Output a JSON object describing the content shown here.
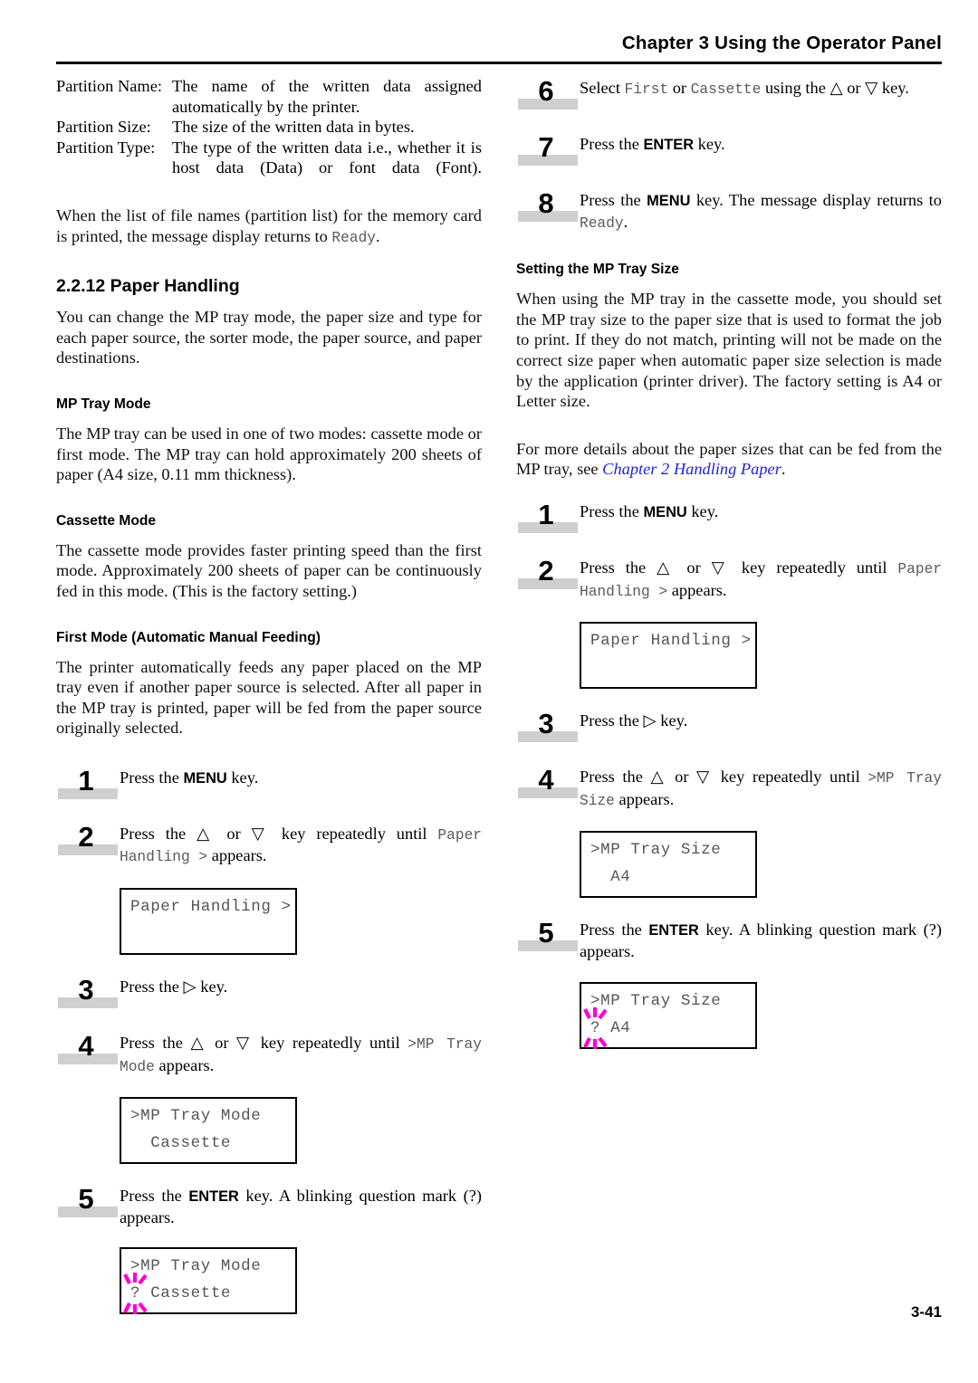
{
  "header": {
    "title": "Chapter 3  Using the Operator Panel"
  },
  "footer": {
    "page_number": "3-41"
  },
  "colors": {
    "link": "#2222dd",
    "blink_marker": "#ff00cc",
    "step_bar": "#cfcfcf",
    "lcd_text": "#555555"
  },
  "left_column": {
    "definitions": [
      {
        "term": "Partition Name:",
        "desc": "The name of the written data assigned automatically by the printer."
      },
      {
        "term": "Partition Size:",
        "desc": "The size of the written data in bytes."
      },
      {
        "term": "Partition Type:",
        "desc": "The type of the written data i.e., whether it is host data (Data) or font data (Font)."
      }
    ],
    "intro_paragraph_a": "When the list of file names (partition list) for the memory card is printed, the message display returns to ",
    "intro_paragraph_b": "Ready",
    "intro_paragraph_c": ".",
    "section_heading": "2.2.12 Paper Handling",
    "section_paragraph": "You can change the MP tray mode, the paper size and type for each paper source, the sorter mode, the paper source, and paper destinations.",
    "mp_tray_mode_heading": "MP Tray Mode",
    "mp_tray_mode_paragraph": "The MP tray can be used in one of two modes: cassette mode or first mode. The MP tray can hold approximately 200 sheets of paper (A4 size, 0.11 mm thickness).",
    "cassette_mode_heading": "Cassette Mode",
    "cassette_mode_paragraph": "The cassette mode provides faster printing speed than the first mode. Approximately 200 sheets of paper can be continuously fed in this mode. (This is the factory setting.)",
    "first_mode_heading": "First Mode (Automatic Manual Feeding)",
    "first_mode_paragraph": "The printer automatically feeds any paper placed on the MP tray even if another paper source is selected. After all paper in the MP tray is printed, paper will be fed from the paper source originally selected.",
    "steps": [
      {
        "number": "1",
        "text_a": "Press the ",
        "key": "MENU",
        "text_b": " key."
      },
      {
        "number": "2",
        "text_a": "Press the ",
        "tri_up": "△",
        "text_or": " or ",
        "tri_down": "▽",
        "text_b": " key repeatedly until ",
        "mono": "Paper Handling >",
        "text_c": " appears."
      },
      {
        "number": "3",
        "text_a": "Press the ",
        "tri_right": "▷",
        "text_b": " key."
      },
      {
        "number": "4",
        "text_a": "Press the ",
        "tri_up": "△",
        "text_or": " or ",
        "tri_down": "▽",
        "text_b": " key repeatedly until ",
        "mono": ">MP Tray Mode",
        "text_c": " appears."
      },
      {
        "number": "5",
        "text_a": "Press the ",
        "key": "ENTER",
        "text_b": " key. A blinking question mark (?) appears."
      }
    ],
    "displays": [
      {
        "line1": "Paper Handling >",
        "line2": ""
      },
      {
        "line1": ">MP Tray Mode",
        "line2": "  Cassette"
      },
      {
        "line1": ">MP Tray Mode",
        "line2": "? Cassette",
        "blinking": "?"
      }
    ]
  },
  "right_column": {
    "steps_top": [
      {
        "number": "6",
        "text_a": "Select ",
        "mono_a": "First",
        "text_b": " or ",
        "mono_b": "Cassette",
        "text_c": " using the ",
        "tri_up": "△",
        "text_or": " or ",
        "tri_down": "▽",
        "text_d": " key."
      },
      {
        "number": "7",
        "text_a": "Press the ",
        "key": "ENTER",
        "text_b": " key."
      },
      {
        "number": "8",
        "text_a": "Press the ",
        "key": "MENU",
        "text_b": " key. The message display returns to ",
        "mono": "Ready",
        "text_c": "."
      }
    ],
    "mp_tray_size_heading": "Setting the MP Tray Size",
    "mp_tray_size_paragraph": "When using the MP tray in the cassette mode, you should set the MP tray size to the paper size that is used to format the job to print. If they do not match, printing will not be made on the correct size paper when automatic paper size selection is made by the application (printer driver). The factory setting is A4 or Letter size.",
    "details_paragraph_a": "For more details about the paper sizes that can be fed from the MP tray, see ",
    "details_link": "Chapter 2 Handling Paper",
    "details_paragraph_b": ".",
    "steps_bottom": [
      {
        "number": "1",
        "text_a": "Press the ",
        "key": "MENU",
        "text_b": " key."
      },
      {
        "number": "2",
        "text_a": "Press the ",
        "tri_up": "△",
        "text_or": " or ",
        "tri_down": "▽",
        "text_b": " key repeatedly until ",
        "mono": "Paper Handling >",
        "text_c": " appears."
      },
      {
        "number": "3",
        "text_a": "Press the ",
        "tri_right": "▷",
        "text_b": " key."
      },
      {
        "number": "4",
        "text_a": "Press the ",
        "tri_up": "△",
        "text_or": " or ",
        "tri_down": "▽",
        "text_b": " key repeatedly until ",
        "mono": ">MP Tray Size",
        "text_c": " appears."
      },
      {
        "number": "5",
        "text_a": "Press the ",
        "key": "ENTER",
        "text_b": " key. A blinking question mark (?) appears."
      }
    ],
    "displays": [
      {
        "line1": "Paper Handling >",
        "line2": ""
      },
      {
        "line1": ">MP Tray Size",
        "line2": "  A4"
      },
      {
        "line1": ">MP Tray Size",
        "line2": "? A4",
        "blinking": "?"
      }
    ]
  }
}
